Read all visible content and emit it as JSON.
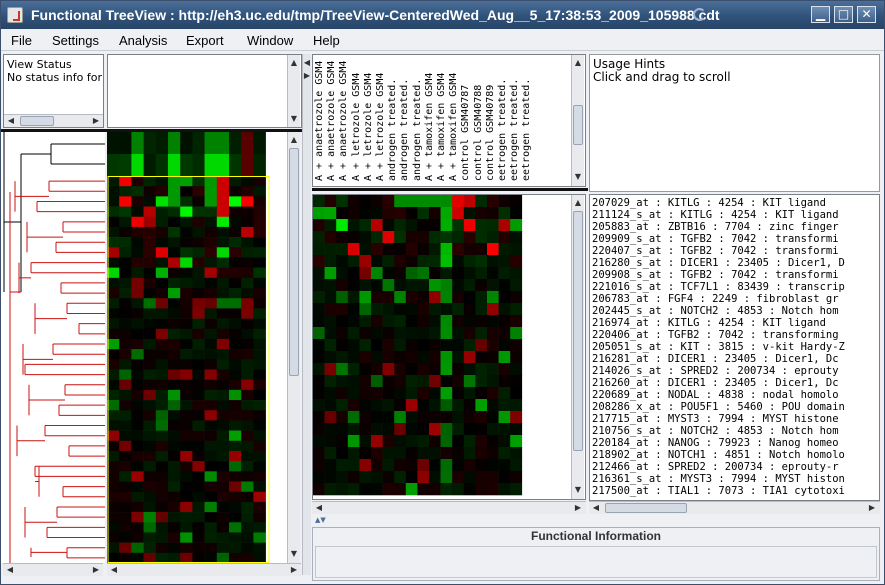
{
  "window": {
    "title": "Functional TreeView : http://eh3.uc.edu/tmp/TreeView-CenteredWed_Aug__5_17:38:53_2009_105988.cdt",
    "buttons": {
      "minimize": "▁",
      "maximize": "□",
      "close": "✕"
    }
  },
  "menu": [
    "File",
    "Settings",
    "Analysis",
    "Export",
    "Window",
    "Help"
  ],
  "status": {
    "title": "View Status",
    "message": "No status info for"
  },
  "hints": {
    "line1": "Usage Hints",
    "line2": "Click and drag to scroll"
  },
  "arrays": [
    "A + anaetrozole GSM4",
    "A + anaetrozole GSM4",
    "A + anaetrozole GSM4",
    "A + letrozole GSM4",
    "A + letrozole GSM4",
    "A + letrozole GSM4",
    "androgen treated.",
    "androgen treated.",
    "androgen treated.",
    "A + tamoxifen GSM4",
    "A + tamoxifen GSM4",
    "A + tamoxifen GSM4",
    "control GSM40787",
    "control GSM40788",
    "control GSM40789",
    "eetrogen treated.",
    "eetrogen treated.",
    "eetrogen treated."
  ],
  "genes": [
    "207029_at : KITLG : 4254 : KIT ligand",
    "211124_s_at : KITLG : 4254 : KIT ligand",
    "205883_at : ZBTB16 : 7704 : zinc finger",
    "209909_s_at : TGFB2 : 7042 : transformi",
    "220407_s_at : TGFB2 : 7042 : transformi",
    "216280_s_at : DICER1 : 23405 : Dicer1, D",
    "209908_s_at : TGFB2 : 7042 : transformi",
    "221016_s_at : TCF7L1 : 83439 : transcrip",
    "206783_at : FGF4 : 2249 : fibroblast gr",
    "202445_s_at : NOTCH2 : 4853 : Notch hom",
    "216974_at : KITLG : 4254 : KIT ligand",
    "220406_at : TGFB2 : 7042 : transforming",
    "205051_s_at : KIT : 3815 : v-kit Hardy-Z",
    "216281_at : DICER1 : 23405 : Dicer1, Dc",
    "214026_s_at : SPRED2 : 200734 : eprouty",
    "216260_at : DICER1 : 23405 : Dicer1, Dc",
    "220689_at : NODAL : 4838 : nodal homolo",
    "208286_x_at : POU5F1 : 5460 : POU domain",
    "217715_at : MYST3 : 7994 : MYST histone",
    "210756_s_at : NOTCH2 : 4853 : Notch hom",
    "220184_at : NANOG : 79923 : Nanog homeo",
    "218902_at : NOTCH1 : 4851 : Notch homolo",
    "212466_at : SPRED2 : 200734 : eprouty-r",
    "216361_s_at : MYST3 : 7994 : MYST histon",
    "217500_at : TIAL1 : 7073 : TIA1 cytotoxi"
  ],
  "functional_info": {
    "title": "Functional Information",
    "content": ""
  },
  "colors": {
    "tree_top": "#000000",
    "tree_selected": "#cc1111",
    "heat_red": "#ff0000",
    "heat_green": "#00ff00",
    "zoom_border": "#ffff00"
  }
}
